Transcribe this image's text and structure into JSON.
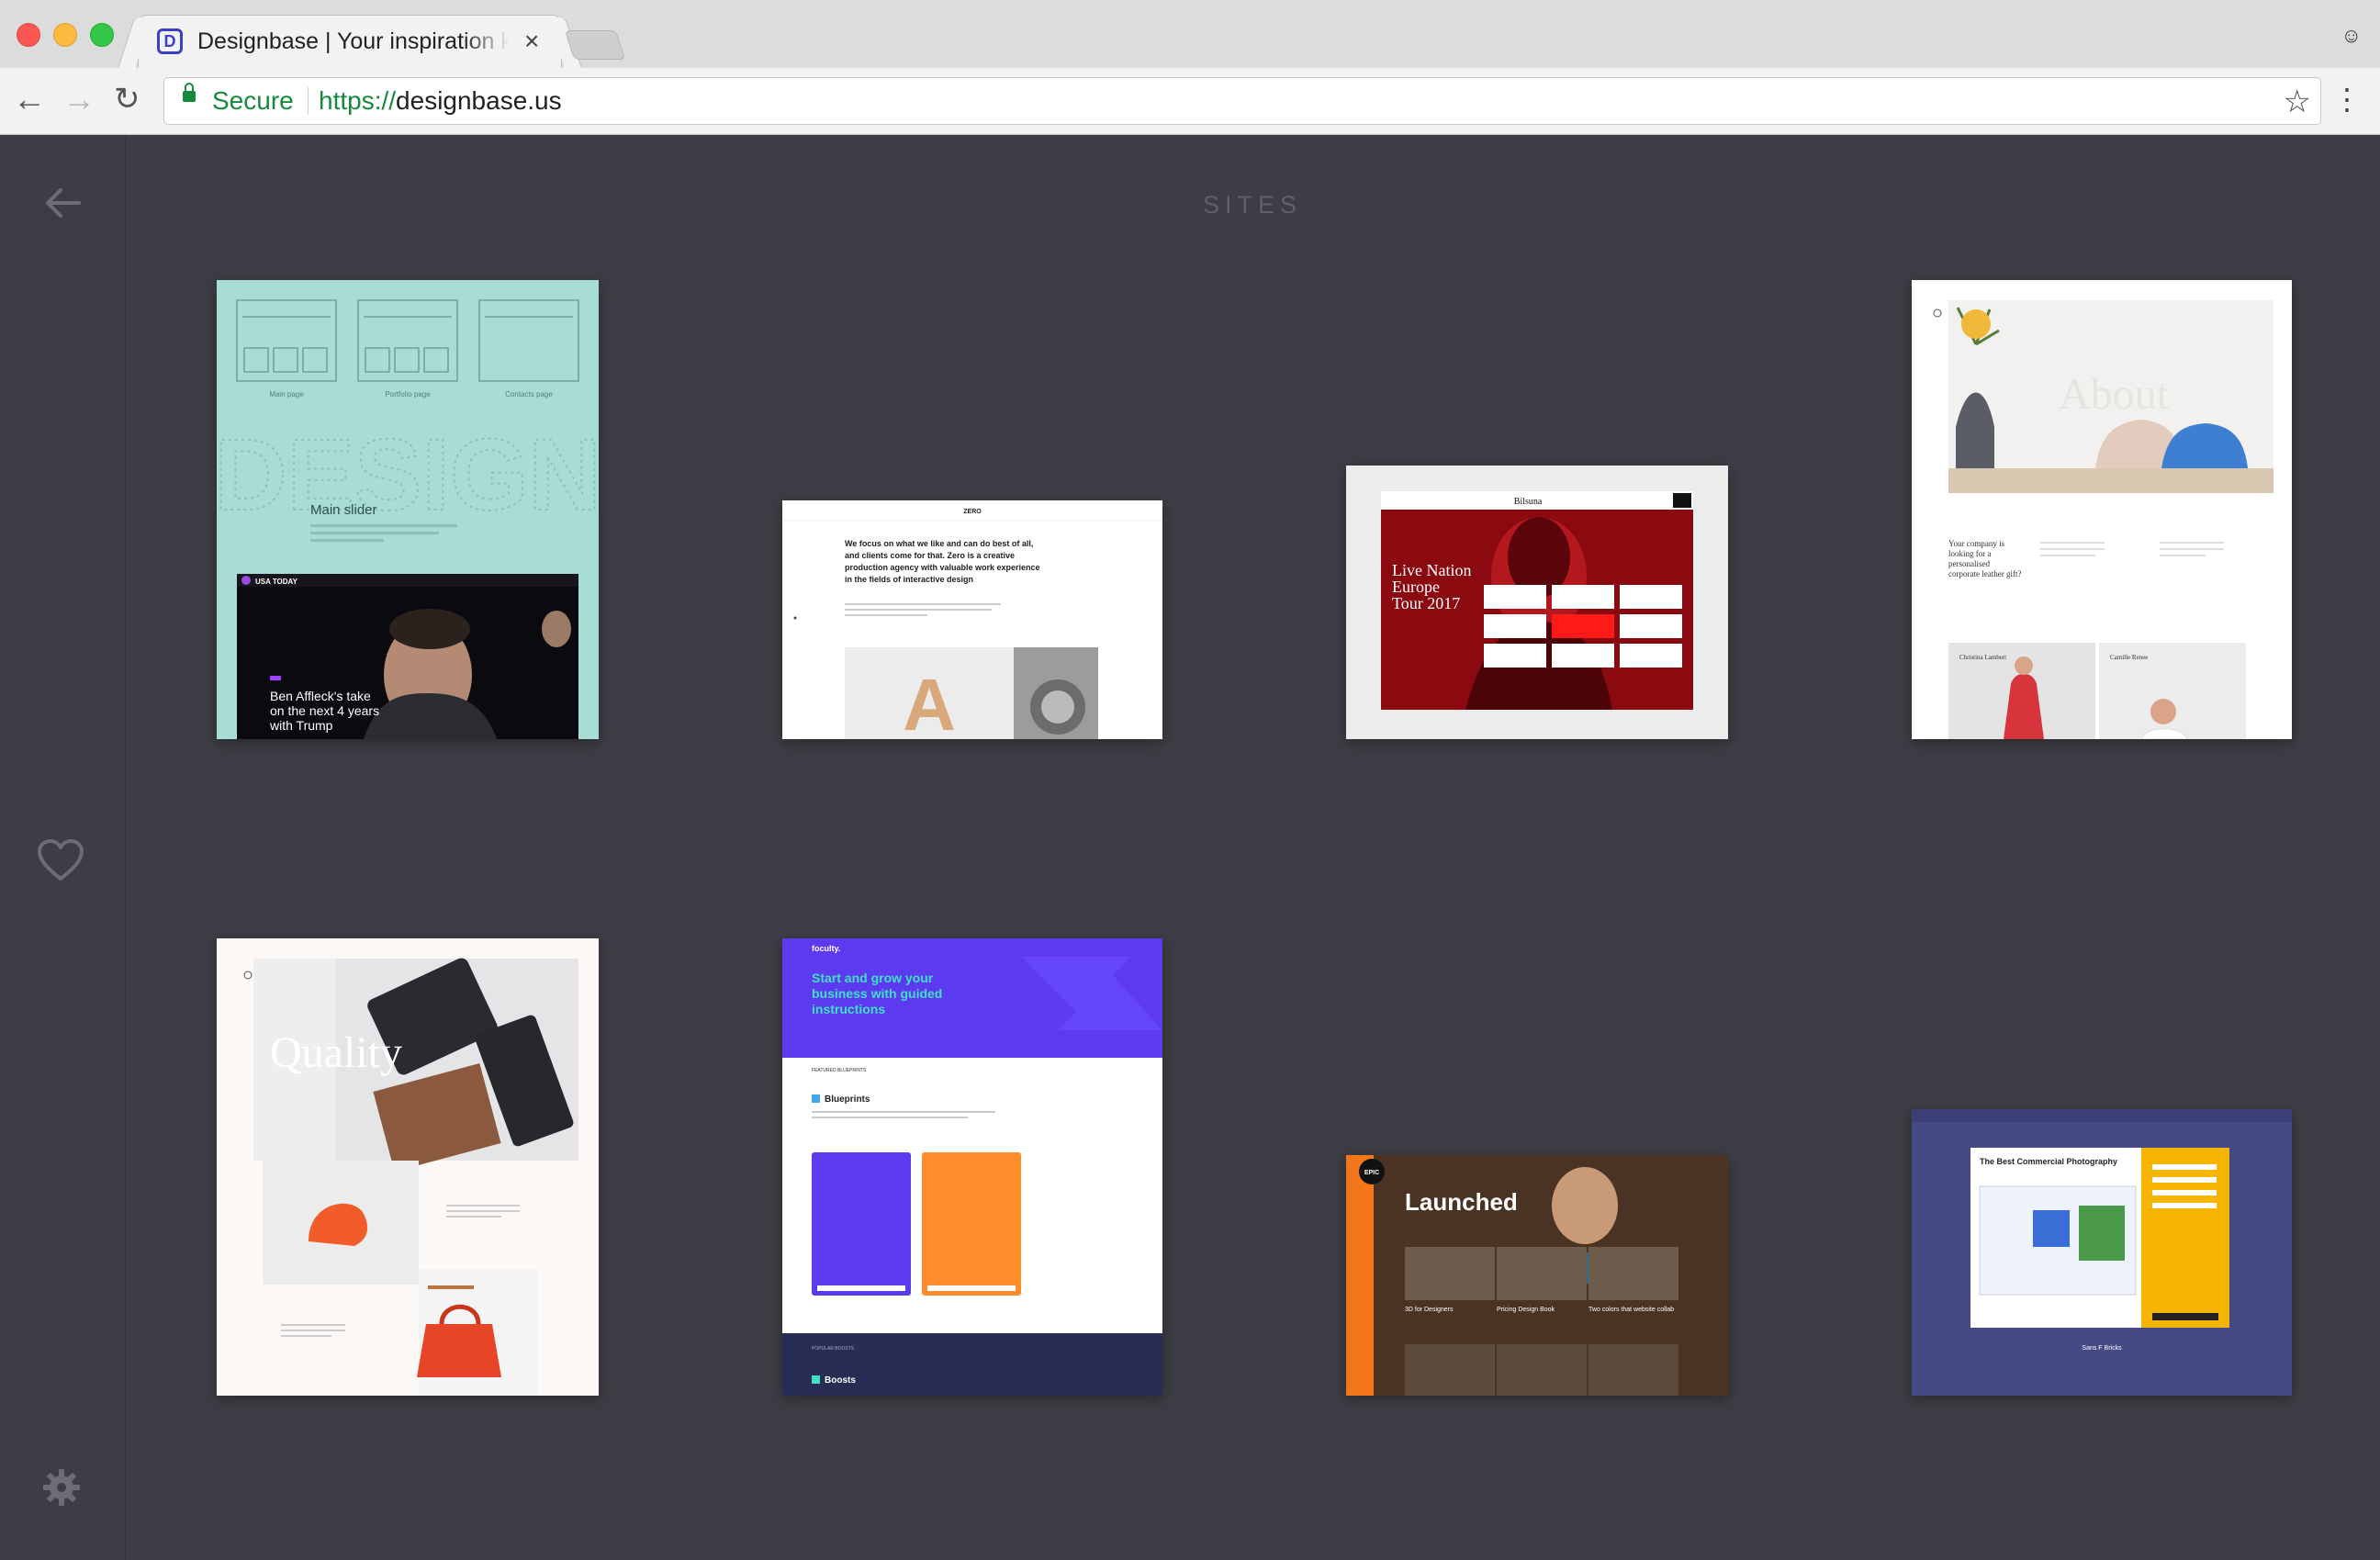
{
  "browser": {
    "tab_title": "Designbase | Your inspiration k",
    "favicon_letter": "D",
    "secure_label": "Secure",
    "url_scheme": "https://",
    "url_host": "designbase.us"
  },
  "page": {
    "section_title": "SITES"
  },
  "thumbnails": {
    "t1": {
      "labels": [
        "Main page",
        "Portfolio page",
        "Contacts page"
      ],
      "big_word": "DESIGN",
      "slider_title": "Main slider",
      "brand": "USA TODAY",
      "headline_1": "Ben Affleck's take",
      "headline_2": "on the next 4 years",
      "headline_3": "with Trump"
    },
    "t2": {
      "logo": "ZERO",
      "line_1": "We focus on what we like and can do best of all,",
      "line_2": "and clients come for that. Zero is a creative",
      "line_3": "production agency with valuable work experience",
      "line_4": "in the fields of interactive design",
      "letter": "A"
    },
    "t3": {
      "logo": "Bilsuna",
      "title_1": "Live Nation",
      "title_2": "Europe",
      "title_3": "Tour 2017"
    },
    "t4": {
      "word": "About",
      "intro_1": "Your company is",
      "intro_2": "looking for a",
      "intro_3": "personalised",
      "intro_4": "corporate leather gift?",
      "name_1": "Christina Lambert",
      "name_2": "Camille Renee"
    },
    "t5": {
      "word": "Quality"
    },
    "t6": {
      "logo": "foculty.",
      "hero_1": "Start and grow your",
      "hero_2": "business with guided",
      "hero_3": "instructions",
      "section": "Blueprints",
      "footer_label": "POPULAR BOOSTS",
      "footer_title": "Boosts",
      "featured": "FEATURED BLUEPRINTS"
    },
    "t7": {
      "badge": "EPIC",
      "title": "Launched",
      "item_1": "3D for Designers",
      "item_2": "Pricing Design Book",
      "item_3": "Two colors that website collab"
    },
    "t8": {
      "title": "The Best Commercial Photography",
      "footer": "Sans F Bricks"
    }
  },
  "colors": {
    "accent_green": "#158a3c",
    "app_bg": "#3d3e45",
    "sidebar_icon": "#6b6c75"
  }
}
